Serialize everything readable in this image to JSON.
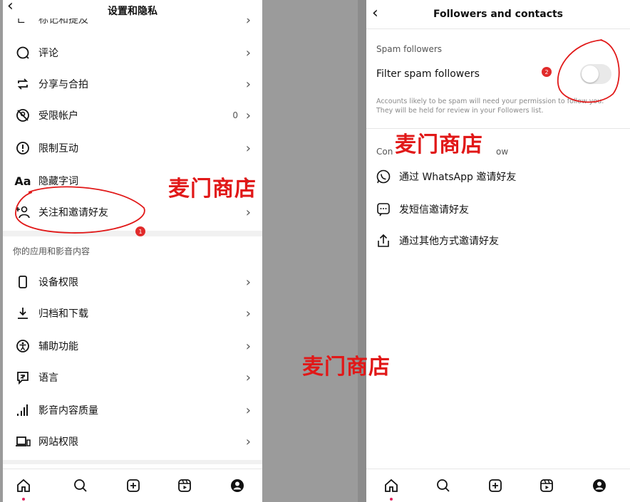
{
  "left": {
    "header": {
      "back_icon": "chevron-left-icon",
      "title": "设置和隐私",
      "cut_item": "标记和提及"
    },
    "items": [
      {
        "label": "评论",
        "icon": "comment-icon"
      },
      {
        "label": "分享与合拍",
        "icon": "share-remix-icon"
      },
      {
        "label": "受限帐户",
        "icon": "restricted-icon",
        "count": "0"
      },
      {
        "label": "限制互动",
        "icon": "limit-icon"
      },
      {
        "label": "隐藏字词",
        "icon": "aa-icon",
        "glyph": "Aa"
      },
      {
        "label": "关注和邀请好友",
        "icon": "add-person-icon"
      }
    ],
    "section_title": "你的应用和影音内容",
    "items2": [
      {
        "label": "设备权限",
        "icon": "phone-icon"
      },
      {
        "label": "归档和下载",
        "icon": "download-icon"
      },
      {
        "label": "辅助功能",
        "icon": "accessibility-icon"
      },
      {
        "label": "语言",
        "icon": "language-icon"
      },
      {
        "label": "影音内容质量",
        "icon": "signal-icon"
      },
      {
        "label": "网站权限",
        "icon": "laptop-icon"
      }
    ],
    "chevron": "›",
    "badge": "1"
  },
  "right": {
    "header": {
      "back_icon": "chevron-left-icon",
      "title": "Followers and contacts"
    },
    "spam_section": "Spam followers",
    "filter_label": "Filter spam followers",
    "filter_on": false,
    "description": "Accounts likely to be spam will need your permission to follow you. They will be held for review in your Followers list.",
    "contacts_section_fragment_a": "Con",
    "contacts_section_fragment_b": "ow",
    "invites": [
      {
        "label": "通过 WhatsApp 邀请好友",
        "icon": "whatsapp-icon"
      },
      {
        "label": "发短信邀请好友",
        "icon": "message-icon"
      },
      {
        "label": "通过其他方式邀请好友",
        "icon": "share-icon"
      }
    ],
    "badge": "2"
  },
  "watermark": "麦门商店",
  "tabbar": [
    "home-icon",
    "search-icon",
    "create-icon",
    "reels-icon",
    "profile-icon"
  ],
  "colors": {
    "annotation": "#e11818",
    "badge": "#e12b2b",
    "watermark": "#e11818"
  }
}
